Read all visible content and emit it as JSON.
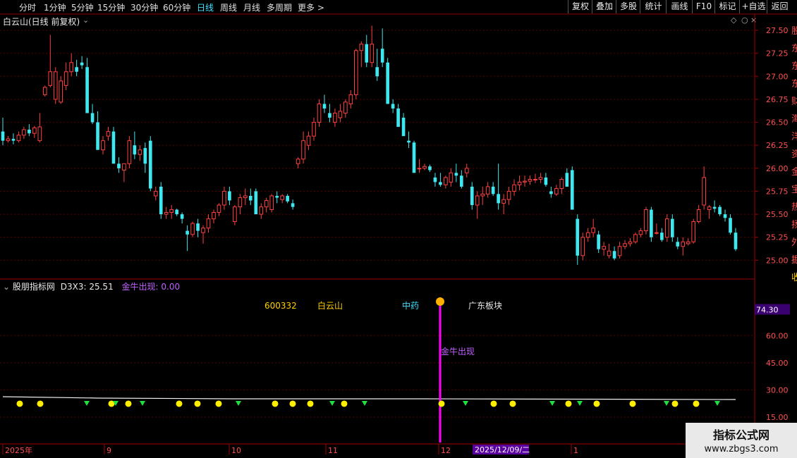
{
  "toolbar": {
    "left": [
      "分时",
      "1分钟",
      "5分钟",
      "15分钟",
      "30分钟",
      "60分钟",
      "日线",
      "周线",
      "月线",
      "多周期",
      "更多 >"
    ],
    "active_index": 6,
    "right": [
      "复权",
      "叠加",
      "多股",
      "统计",
      "画线",
      "F10",
      "标记",
      "+自选",
      "返回"
    ]
  },
  "main_title": "白云山(日线 前复权)",
  "sub": {
    "indicator": "股朋指标网",
    "d3x3_label": "D3X3:",
    "d3x3_value": "25.51",
    "jinniu_label": "金牛出现:",
    "jinniu_value": "0.00"
  },
  "info": {
    "code": "600332",
    "name": "白云山",
    "sector": "中药",
    "region": "广东板块"
  },
  "marker_label": "金牛出现",
  "date_axis": {
    "labels": [
      "2025年",
      "9",
      "10",
      "11",
      "12",
      "1"
    ],
    "cursor_date": "2025/12/09/二"
  },
  "watermark": {
    "line1": "指标公式网",
    "line2": "www.zbgs3.com"
  },
  "colors": {
    "up": "#ff4040",
    "down": "#3ee8f0",
    "purple": "#c060ff",
    "magenta": "#ff00ff"
  },
  "right_edge_text": [
    "股",
    "东",
    "东",
    "东",
    "财",
    "海",
    "洋",
    "资",
    "金",
    "宝",
    "热",
    "扬",
    "外",
    "掘",
    "收"
  ],
  "sub_axis_top": "74.30",
  "chart_data": [
    {
      "type": "candlestick",
      "title": "白云山(日线 前复权)",
      "ylim": [
        24.88,
        27.6
      ],
      "y_ticks": [
        25.0,
        25.25,
        25.5,
        25.75,
        26.0,
        26.25,
        26.5,
        26.75,
        27.0,
        27.25,
        27.5
      ],
      "ohlc": [
        [
          26.4,
          26.55,
          26.25,
          26.3
        ],
        [
          26.3,
          26.35,
          26.28,
          26.32
        ],
        [
          26.32,
          26.38,
          26.26,
          26.3
        ],
        [
          26.3,
          26.4,
          26.28,
          26.36
        ],
        [
          26.36,
          26.45,
          26.32,
          26.42
        ],
        [
          26.42,
          26.48,
          26.35,
          26.38
        ],
        [
          26.38,
          26.46,
          26.33,
          26.44
        ],
        [
          26.3,
          26.6,
          26.28,
          26.45
        ],
        [
          26.8,
          26.9,
          26.78,
          26.88
        ],
        [
          26.9,
          27.45,
          26.88,
          27.05
        ],
        [
          26.75,
          27.1,
          26.7,
          27.05
        ],
        [
          26.72,
          27.0,
          26.7,
          26.95
        ],
        [
          26.9,
          27.15,
          26.85,
          27.05
        ],
        [
          27.05,
          27.25,
          27.0,
          27.15
        ],
        [
          27.1,
          27.18,
          27.0,
          27.05
        ],
        [
          27.15,
          27.22,
          27.08,
          27.12
        ],
        [
          27.1,
          27.2,
          26.6,
          26.6
        ],
        [
          26.6,
          26.7,
          26.48,
          26.5
        ],
        [
          26.5,
          26.62,
          26.2,
          26.2
        ],
        [
          26.2,
          26.35,
          26.15,
          26.3
        ],
        [
          26.35,
          26.45,
          26.3,
          26.4
        ],
        [
          26.4,
          26.45,
          26.05,
          26.05
        ],
        [
          26.05,
          26.12,
          25.95,
          26.0
        ],
        [
          25.98,
          26.05,
          25.85,
          26.05
        ],
        [
          26.05,
          26.35,
          26.0,
          26.3
        ],
        [
          26.25,
          26.4,
          26.1,
          26.15
        ],
        [
          26.15,
          26.25,
          26.08,
          26.2
        ],
        [
          26.22,
          26.28,
          25.95,
          26.05
        ],
        [
          26.3,
          26.35,
          25.75,
          25.78
        ],
        [
          25.7,
          25.8,
          25.65,
          25.75
        ],
        [
          25.8,
          25.85,
          25.45,
          25.5
        ],
        [
          25.5,
          25.58,
          25.45,
          25.52
        ],
        [
          25.52,
          25.6,
          25.45,
          25.55
        ],
        [
          25.55,
          25.56,
          25.48,
          25.5
        ],
        [
          25.5,
          25.52,
          25.4,
          25.45
        ],
        [
          25.32,
          25.38,
          25.1,
          25.28
        ],
        [
          25.28,
          25.42,
          25.25,
          25.4
        ],
        [
          25.4,
          25.45,
          25.25,
          25.32
        ],
        [
          25.3,
          25.38,
          25.18,
          25.35
        ],
        [
          25.35,
          25.5,
          25.3,
          25.45
        ],
        [
          25.45,
          25.55,
          25.4,
          25.52
        ],
        [
          25.52,
          25.62,
          25.48,
          25.6
        ],
        [
          25.6,
          25.8,
          25.55,
          25.75
        ],
        [
          25.75,
          25.8,
          25.6,
          25.65
        ],
        [
          25.42,
          25.6,
          25.38,
          25.58
        ],
        [
          25.58,
          25.72,
          25.5,
          25.68
        ],
        [
          25.68,
          25.78,
          25.6,
          25.7
        ],
        [
          25.7,
          25.78,
          25.6,
          25.65
        ],
        [
          25.75,
          25.78,
          25.5,
          25.5
        ],
        [
          25.5,
          25.62,
          25.45,
          25.58
        ],
        [
          25.58,
          25.68,
          25.52,
          25.65
        ],
        [
          25.55,
          25.72,
          25.52,
          25.7
        ],
        [
          25.7,
          25.75,
          25.62,
          25.68
        ],
        [
          25.66,
          25.72,
          25.62,
          25.7
        ],
        [
          25.7,
          25.72,
          25.62,
          25.64
        ],
        [
          25.62,
          25.66,
          25.55,
          25.58
        ],
        [
          26.05,
          26.12,
          26.0,
          26.1
        ],
        [
          26.1,
          26.4,
          26.05,
          26.3
        ],
        [
          26.25,
          26.4,
          26.2,
          26.35
        ],
        [
          26.35,
          26.55,
          26.3,
          26.5
        ],
        [
          26.5,
          26.75,
          26.45,
          26.7
        ],
        [
          26.7,
          26.8,
          26.6,
          26.65
        ],
        [
          26.6,
          26.7,
          26.5,
          26.55
        ],
        [
          26.5,
          26.65,
          26.45,
          26.6
        ],
        [
          26.55,
          26.7,
          26.5,
          26.62
        ],
        [
          26.6,
          26.75,
          26.55,
          26.72
        ],
        [
          26.7,
          26.85,
          26.65,
          26.8
        ],
        [
          26.8,
          27.3,
          26.75,
          27.28
        ],
        [
          27.28,
          27.38,
          27.1,
          27.35
        ],
        [
          27.35,
          27.45,
          27.1,
          27.15
        ],
        [
          27.15,
          27.55,
          27.1,
          27.35
        ],
        [
          27.1,
          27.3,
          26.95,
          27.0
        ],
        [
          27.3,
          27.52,
          27.1,
          27.15
        ],
        [
          27.15,
          27.2,
          26.7,
          26.7
        ],
        [
          26.7,
          26.75,
          26.6,
          26.65
        ],
        [
          26.65,
          26.7,
          26.45,
          26.45
        ],
        [
          26.55,
          26.6,
          26.35,
          26.35
        ],
        [
          26.3,
          26.4,
          26.22,
          26.28
        ],
        [
          26.28,
          26.3,
          25.95,
          25.95
        ],
        [
          26.0,
          26.1,
          25.95,
          26.0
        ],
        [
          26.0,
          26.05,
          25.98,
          26.02
        ],
        [
          26.02,
          26.04,
          25.96,
          25.98
        ],
        [
          25.9,
          25.95,
          25.8,
          25.85
        ],
        [
          25.85,
          25.95,
          25.8,
          25.82
        ],
        [
          25.82,
          25.92,
          25.78,
          25.9
        ],
        [
          25.85,
          26.0,
          25.8,
          25.95
        ],
        [
          25.95,
          26.05,
          25.85,
          25.92
        ],
        [
          25.92,
          25.98,
          25.78,
          25.8
        ],
        [
          25.95,
          26.05,
          25.9,
          26.0
        ],
        [
          25.8,
          25.85,
          25.55,
          25.6
        ],
        [
          25.6,
          25.75,
          25.45,
          25.7
        ],
        [
          25.7,
          25.8,
          25.6,
          25.72
        ],
        [
          25.72,
          25.85,
          25.68,
          25.8
        ],
        [
          25.8,
          25.85,
          25.7,
          25.72
        ],
        [
          25.72,
          26.05,
          25.55,
          25.62
        ],
        [
          25.62,
          25.72,
          25.5,
          25.66
        ],
        [
          25.66,
          25.8,
          25.6,
          25.75
        ],
        [
          25.75,
          25.88,
          25.7,
          25.82
        ],
        [
          25.82,
          25.92,
          25.76,
          25.85
        ],
        [
          25.85,
          25.92,
          25.8,
          25.86
        ],
        [
          25.86,
          25.92,
          25.82,
          25.88
        ],
        [
          25.88,
          25.94,
          25.84,
          25.88
        ],
        [
          25.88,
          25.95,
          25.84,
          25.9
        ],
        [
          25.9,
          25.95,
          25.8,
          25.82
        ],
        [
          25.75,
          25.8,
          25.68,
          25.72
        ],
        [
          25.72,
          25.82,
          25.7,
          25.78
        ],
        [
          25.78,
          25.9,
          25.72,
          25.88
        ],
        [
          25.95,
          26.0,
          25.8,
          25.8
        ],
        [
          25.98,
          26.02,
          25.55,
          25.55
        ],
        [
          25.45,
          25.5,
          24.95,
          25.05
        ],
        [
          25.05,
          25.3,
          25.0,
          25.25
        ],
        [
          25.25,
          25.35,
          25.2,
          25.3
        ],
        [
          25.3,
          25.45,
          25.25,
          25.35
        ],
        [
          25.28,
          25.32,
          25.08,
          25.12
        ],
        [
          25.12,
          25.2,
          25.05,
          25.15
        ],
        [
          25.05,
          25.18,
          25.02,
          25.1
        ],
        [
          25.1,
          25.15,
          25.0,
          25.02
        ],
        [
          25.05,
          25.2,
          25.02,
          25.15
        ],
        [
          25.15,
          25.22,
          25.12,
          25.18
        ],
        [
          25.18,
          25.24,
          25.15,
          25.2
        ],
        [
          25.2,
          25.3,
          25.18,
          25.28
        ],
        [
          25.28,
          25.35,
          25.25,
          25.32
        ],
        [
          25.32,
          25.58,
          25.28,
          25.55
        ],
        [
          25.55,
          25.58,
          25.2,
          25.25
        ],
        [
          25.3,
          25.4,
          25.28,
          25.3
        ],
        [
          25.3,
          25.35,
          25.2,
          25.22
        ],
        [
          25.25,
          25.5,
          25.2,
          25.45
        ],
        [
          25.45,
          25.5,
          25.2,
          25.25
        ],
        [
          25.2,
          25.25,
          25.12,
          25.15
        ],
        [
          25.15,
          25.25,
          25.05,
          25.2
        ],
        [
          25.18,
          25.24,
          25.16,
          25.2
        ],
        [
          25.2,
          25.45,
          25.18,
          25.42
        ],
        [
          25.42,
          25.6,
          25.4,
          25.55
        ],
        [
          25.6,
          26.02,
          25.55,
          25.9
        ],
        [
          25.55,
          25.6,
          25.45,
          25.58
        ],
        [
          25.58,
          25.65,
          25.52,
          25.56
        ],
        [
          25.58,
          25.6,
          25.48,
          25.5
        ],
        [
          25.5,
          25.55,
          25.42,
          25.46
        ],
        [
          25.46,
          25.5,
          25.28,
          25.3
        ],
        [
          25.3,
          25.35,
          25.1,
          25.12
        ]
      ]
    },
    {
      "type": "line",
      "title": "股朋指标网",
      "y_ticks": [
        15.0,
        30.0,
        45.0,
        60.0,
        74.3
      ],
      "ylim": [
        8,
        78
      ],
      "series": [
        {
          "name": "D3X3",
          "values": [
            25.51
          ]
        },
        {
          "name": "金牛出现",
          "values": [
            0.0
          ]
        }
      ]
    }
  ]
}
